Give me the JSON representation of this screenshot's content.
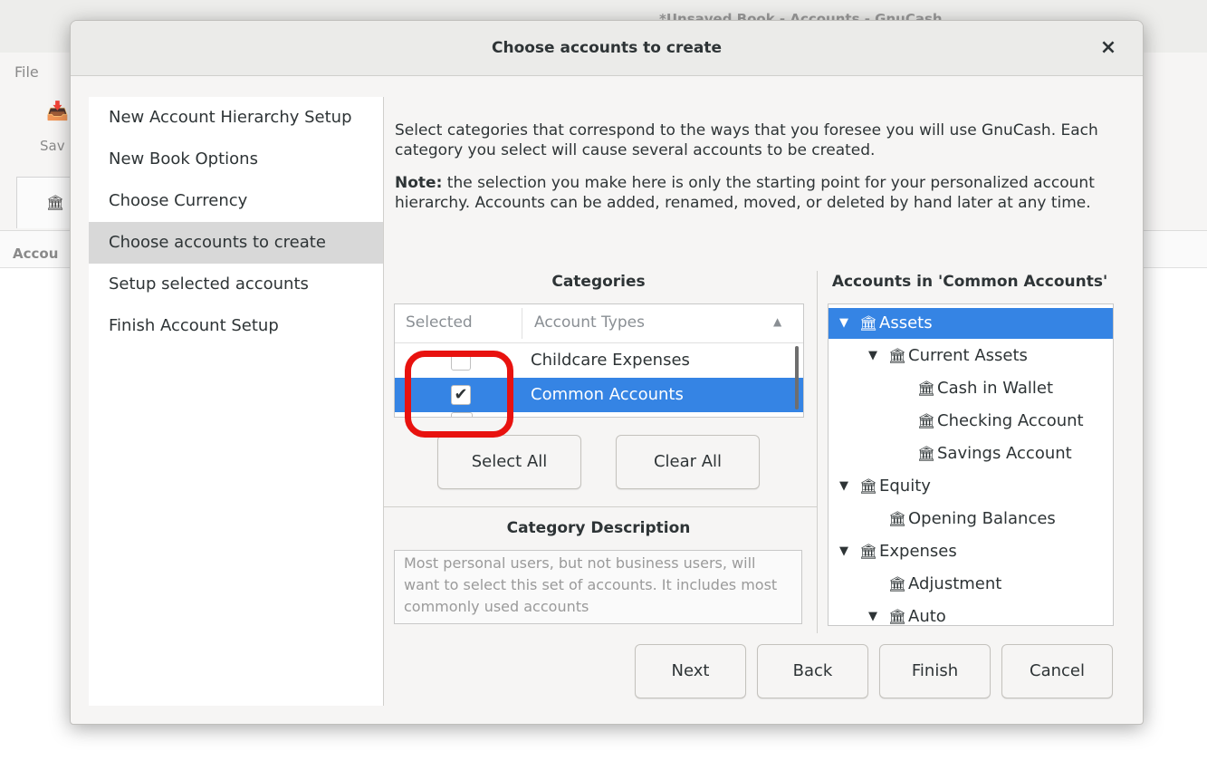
{
  "background": {
    "window_title": "*Unsaved Book - Accounts - GnuCash",
    "menu_file": "File",
    "toolbar_save": "Sav",
    "column_label": "Accou"
  },
  "dialog": {
    "title": "Choose accounts to create",
    "close_glyph": "×",
    "steps": [
      {
        "label": "New Account Hierarchy Setup"
      },
      {
        "label": "New Book Options"
      },
      {
        "label": "Choose Currency"
      },
      {
        "label": "Choose accounts to create",
        "active": true
      },
      {
        "label": "Setup selected accounts"
      },
      {
        "label": "Finish Account Setup"
      }
    ],
    "intro_text": "Select categories that correspond to the ways that you foresee you will use GnuCash. Each category you select will cause several accounts to be created.",
    "note_label": "Note:",
    "note_text": " the selection you make here is only the starting point for your personalized account hierarchy. Accounts can be added, renamed, moved, or deleted by hand later at any time.",
    "categories": {
      "title": "Categories",
      "col_selected": "Selected",
      "col_types": "Account Types",
      "rows": [
        {
          "name": "Childcare Expenses",
          "checked": false,
          "selected": false
        },
        {
          "name": "Common Accounts",
          "checked": true,
          "selected": true
        }
      ],
      "check_glyph": "✔"
    },
    "buttons": {
      "select_all": "Select All",
      "clear_all": "Clear All",
      "next": "Next",
      "back": "Back",
      "finish": "Finish",
      "cancel": "Cancel"
    },
    "description": {
      "title": "Category Description",
      "text": "Most personal users, but not business users, will want to select this set of accounts. It includes most commonly used accounts"
    },
    "accounts": {
      "title": "Accounts in 'Common Accounts'",
      "tree": [
        {
          "label": "Assets",
          "depth": 0,
          "expander": true,
          "selected": true
        },
        {
          "label": "Current Assets",
          "depth": 1,
          "expander": true
        },
        {
          "label": "Cash in Wallet",
          "depth": 2,
          "expander": false
        },
        {
          "label": "Checking Account",
          "depth": 2,
          "expander": false
        },
        {
          "label": "Savings Account",
          "depth": 2,
          "expander": false
        },
        {
          "label": "Equity",
          "depth": 0,
          "expander": true
        },
        {
          "label": "Opening Balances",
          "depth": 1,
          "expander": false
        },
        {
          "label": "Expenses",
          "depth": 0,
          "expander": true
        },
        {
          "label": "Adjustment",
          "depth": 1,
          "expander": false
        },
        {
          "label": "Auto",
          "depth": 1,
          "expander": true
        }
      ],
      "expander_glyph": "▼",
      "account_icon_glyph": "🏛"
    },
    "colors": {
      "selection": "#3584e4",
      "highlight_ring": "#e8120f"
    }
  }
}
